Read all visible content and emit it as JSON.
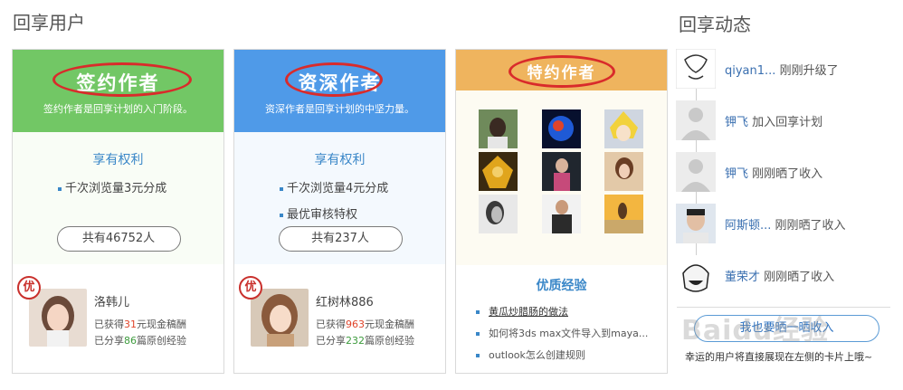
{
  "sections": {
    "users_title": "回享用户",
    "feed_title": "回享动态"
  },
  "cards": [
    {
      "title": "签约作者",
      "subtitle": "签约作者是回享计划的入门阶段。",
      "color": "#72c765",
      "benefit_title": "享有权利",
      "benefits": [
        "千次浏览量3元分成"
      ],
      "count": "共有46752人",
      "badge": "优",
      "author": {
        "name": "洛韩儿",
        "stat1_pre": "已获得",
        "stat1_num": "31",
        "stat1_post": "元现金稿酬",
        "stat2_pre": "已分享",
        "stat2_num": "86",
        "stat2_post": "篇原创经验"
      }
    },
    {
      "title": "资深作者",
      "subtitle": "资深作者是回享计划的中坚力量。",
      "color": "#4f9ae8",
      "benefit_title": "享有权利",
      "benefits": [
        "千次浏览量4元分成",
        "最优审核特权"
      ],
      "count": "共有237人",
      "badge": "优",
      "author": {
        "name": "红树林886",
        "stat1_pre": "已获得",
        "stat1_num": "963",
        "stat1_post": "元现金稿酬",
        "stat2_pre": "已分享",
        "stat2_num": "232",
        "stat2_post": "篇原创经验"
      }
    },
    {
      "title": "特约作者",
      "color": "#efb45e",
      "experience_title": "优质经验",
      "experiences": [
        "黄瓜炒腊肠的做法",
        "如何将3ds max文件导入到maya...",
        "outlook怎么创建规则"
      ]
    }
  ],
  "feed": [
    {
      "user": "qiyan1...",
      "action": "刚刚升级了"
    },
    {
      "user": "钾飞",
      "action": "加入回享计划"
    },
    {
      "user": "钾飞",
      "action": "刚刚晒了收入"
    },
    {
      "user": "阿斯顿...",
      "action": "刚刚晒了收入"
    },
    {
      "user": "董荣才",
      "action": "刚刚晒了收入"
    }
  ],
  "feed_button": "我也要晒一晒收入",
  "feed_tip": "幸运的用户将直接展现在左侧的卡片上哦~",
  "watermark": "Baidu经验"
}
